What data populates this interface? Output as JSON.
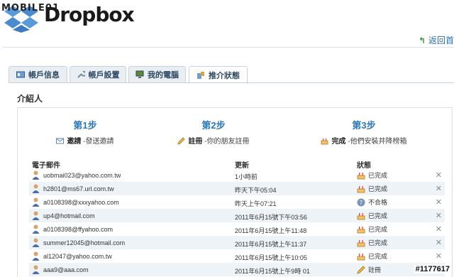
{
  "watermark_top": "MOBILE01",
  "brand": "Dropbox",
  "back_link": "返回首",
  "tabs": [
    {
      "label": "帳戶信息"
    },
    {
      "label": "帳戶設置"
    },
    {
      "label": "我的電腦"
    },
    {
      "label": "推介狀態"
    }
  ],
  "section_title": "介紹人",
  "steps": [
    {
      "title": "第1步",
      "action": "邀請",
      "desc": " -發送邀請"
    },
    {
      "title": "第2步",
      "action": "註冊",
      "desc": " -你的朋友註冊"
    },
    {
      "title": "第3步",
      "action": "完成",
      "desc": " -他們安裝并降榜箱"
    }
  ],
  "table": {
    "headers": {
      "email": "電子郵件",
      "updated": "更新",
      "status": "狀態"
    },
    "rows": [
      {
        "email": "uobmai023@yahoo.com.tw",
        "updated": "1小時前",
        "status": "已完成",
        "icon": "cake"
      },
      {
        "email": "h2801@ms67.url.com.tw",
        "updated": "昨天下午05:04",
        "status": "已完成",
        "icon": "cake"
      },
      {
        "email": "a0108398@xxxyahoo.com",
        "updated": "昨天上午07:21",
        "status": "不合格",
        "icon": "question"
      },
      {
        "email": "up4@hotmail.com",
        "updated": "2011年6月15號下午03:56",
        "status": "已完成",
        "icon": "cake"
      },
      {
        "email": "a0108398@ffyahoo.com",
        "updated": "2011年6月15號上午11:48",
        "status": "已完成",
        "icon": "cake"
      },
      {
        "email": "summer12045@hotmail.com",
        "updated": "2011年6月15號上午11:37",
        "status": "已完成",
        "icon": "cake"
      },
      {
        "email": "al12047@yahoo.com.tw",
        "updated": "2011年6月15號上午10:05",
        "status": "已完成",
        "icon": "cake"
      },
      {
        "email": "aaa9@aaa.com",
        "updated": "2011年6月15號上午9時 01",
        "status": "註冊",
        "icon": "pencil"
      }
    ]
  },
  "watermark_bottom": "#1177617",
  "colors": {
    "link": "#2a6db0",
    "step_title": "#2b78b8",
    "row_alt": "#eef3f8"
  }
}
